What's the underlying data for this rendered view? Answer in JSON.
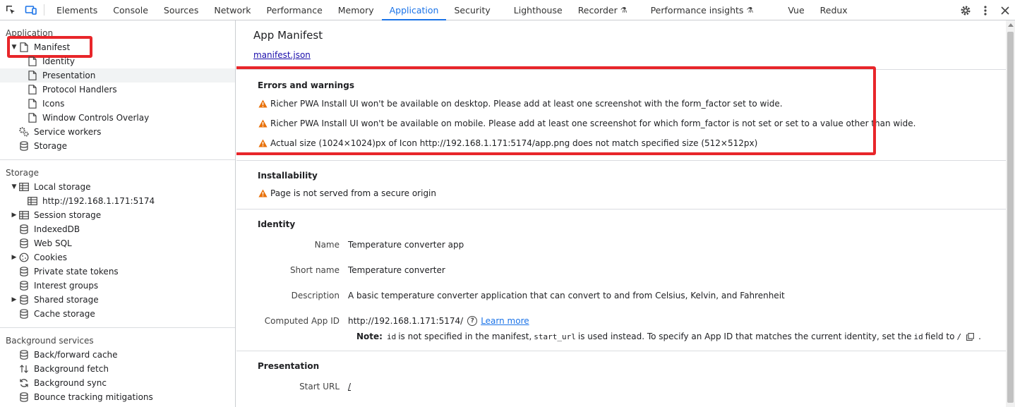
{
  "toolbar": {
    "tabs": [
      {
        "label": "Elements"
      },
      {
        "label": "Console"
      },
      {
        "label": "Sources"
      },
      {
        "label": "Network"
      },
      {
        "label": "Performance"
      },
      {
        "label": "Memory"
      },
      {
        "label": "Application"
      },
      {
        "label": "Security"
      },
      {
        "label": "Lighthouse"
      },
      {
        "label": "Recorder"
      },
      {
        "label": "Performance insights"
      },
      {
        "label": "Vue"
      },
      {
        "label": "Redux"
      }
    ],
    "active_tab": "Application",
    "accent_color": "#1a73e8"
  },
  "sidebar": {
    "application_title": "Application",
    "application_items": [
      {
        "label": "Manifest",
        "icon": "document-icon",
        "expanded": true
      },
      {
        "label": "Identity",
        "icon": "document-icon"
      },
      {
        "label": "Presentation",
        "icon": "document-icon"
      },
      {
        "label": "Protocol Handlers",
        "icon": "document-icon"
      },
      {
        "label": "Icons",
        "icon": "document-icon"
      },
      {
        "label": "Window Controls Overlay",
        "icon": "document-icon"
      },
      {
        "label": "Service workers",
        "icon": "gears-icon"
      },
      {
        "label": "Storage",
        "icon": "database-icon"
      }
    ],
    "storage_title": "Storage",
    "storage_items": [
      {
        "label": "Local storage",
        "icon": "table-icon"
      },
      {
        "label": "http://192.168.1.171:5174",
        "icon": "table-icon"
      },
      {
        "label": "Session storage",
        "icon": "table-icon"
      },
      {
        "label": "IndexedDB",
        "icon": "database-icon"
      },
      {
        "label": "Web SQL",
        "icon": "database-icon"
      },
      {
        "label": "Cookies",
        "icon": "cookie-icon"
      },
      {
        "label": "Private state tokens",
        "icon": "database-icon"
      },
      {
        "label": "Interest groups",
        "icon": "database-icon"
      },
      {
        "label": "Shared storage",
        "icon": "database-icon"
      },
      {
        "label": "Cache storage",
        "icon": "database-icon"
      }
    ],
    "background_title": "Background services",
    "background_items": [
      {
        "label": "Back/forward cache",
        "icon": "database-icon"
      },
      {
        "label": "Background fetch",
        "icon": "updown-arrows-icon"
      },
      {
        "label": "Background sync",
        "icon": "sync-icon"
      },
      {
        "label": "Bounce tracking mitigations",
        "icon": "database-icon"
      }
    ]
  },
  "main": {
    "title": "App Manifest",
    "manifest_link": "manifest.json",
    "errors": {
      "title": "Errors and warnings",
      "items": [
        "Richer PWA Install UI won't be available on desktop. Please add at least one screenshot with the form_factor set to wide.",
        "Richer PWA Install UI won't be available on mobile. Please add at least one screenshot for which form_factor is not set or set to a value other than wide.",
        "Actual size (1024×1024)px of Icon http://192.168.1.171:5174/app.png does not match specified size (512×512px)"
      ]
    },
    "installability": {
      "title": "Installability",
      "items": [
        "Page is not served from a secure origin"
      ]
    },
    "identity": {
      "title": "Identity",
      "name_label": "Name",
      "name_value": "Temperature converter app",
      "short_name_label": "Short name",
      "short_name_value": "Temperature converter",
      "description_label": "Description",
      "description_value": "A basic temperature converter application that can convert to and from Celsius, Kelvin, and Fahrenheit",
      "app_id_label": "Computed App ID",
      "app_id_value": "http://192.168.1.171:5174/",
      "learn_more": "Learn more",
      "note_label": "Note:",
      "note_code_id": "id",
      "note_text_1": "is not specified in the manifest,",
      "note_code_start": "start_url",
      "note_text_2": "is used instead. To specify an App ID that matches the current identity, set the",
      "note_code_id2": "id",
      "note_text_3": "field to",
      "note_code_slash": "/",
      "note_end": "."
    },
    "presentation": {
      "title": "Presentation",
      "start_url_label": "Start URL",
      "start_url_value": "/"
    }
  },
  "colors": {
    "warning": "#e8710a",
    "highlight_box": "#e8262a"
  }
}
